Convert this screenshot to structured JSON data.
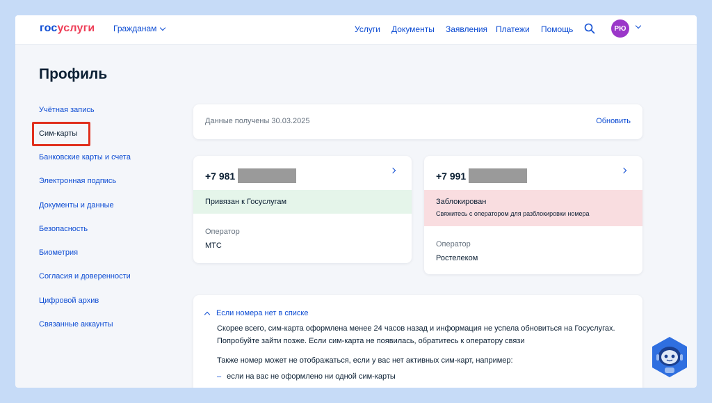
{
  "header": {
    "logo_part1": "гос",
    "logo_part2": "услуги",
    "audience": "Гражданам",
    "nav": [
      "Услуги",
      "Документы",
      "Заявления",
      "Платежи",
      "Помощь"
    ],
    "avatar_initials": "РЮ"
  },
  "page_title": "Профиль",
  "sidebar": {
    "items": [
      {
        "label": "Учётная запись"
      },
      {
        "label": "Сим-карты"
      },
      {
        "label": "Банковские карты и счета"
      },
      {
        "label": "Электронная подпись"
      },
      {
        "label": "Документы и данные"
      },
      {
        "label": "Безопасность"
      },
      {
        "label": "Биометрия"
      },
      {
        "label": "Согласия и доверенности"
      },
      {
        "label": "Цифровой архив"
      },
      {
        "label": "Связанные аккаунты"
      }
    ],
    "active_index": 1
  },
  "data_bar": {
    "received_text": "Данные получены 30.03.2025",
    "refresh_label": "Обновить"
  },
  "sim_cards": [
    {
      "phone_prefix": "+7 981",
      "status_title": "Привязан к Госуслугам",
      "status_sub": "",
      "operator_label": "Оператор",
      "operator": "МТС"
    },
    {
      "phone_prefix": "+7 991",
      "status_title": "Заблокирован",
      "status_sub": "Свяжитесь с оператором для разблокировки номера",
      "operator_label": "Оператор",
      "operator": "Ростелеком"
    }
  ],
  "info": {
    "toggle_label": "Если номера нет в списке",
    "line1": "Скорее всего, сим-карта оформлена менее 24 часов назад и информация не успела обновиться на Госуслугах.",
    "line2": "Попробуйте зайти позже. Если сим-карта не появилась, обратитесь к оператору связи",
    "line3": "Также номер может не отображаться, если у вас нет активных сим-карт, например:",
    "bullet1": "если на вас не оформлено ни одной сим-карты"
  },
  "colors": {
    "accent": "#0d4cd3",
    "brand_red": "#ee3f58",
    "status_ok_bg": "#e5f5ea",
    "status_bad_bg": "#f9dde0",
    "highlight": "#e0301e",
    "avatar_bg": "#9b37c9"
  },
  "icons": [
    "search-icon",
    "chevron-down-icon",
    "chevron-right-icon",
    "chevron-up-icon",
    "assistant-robot-icon"
  ]
}
